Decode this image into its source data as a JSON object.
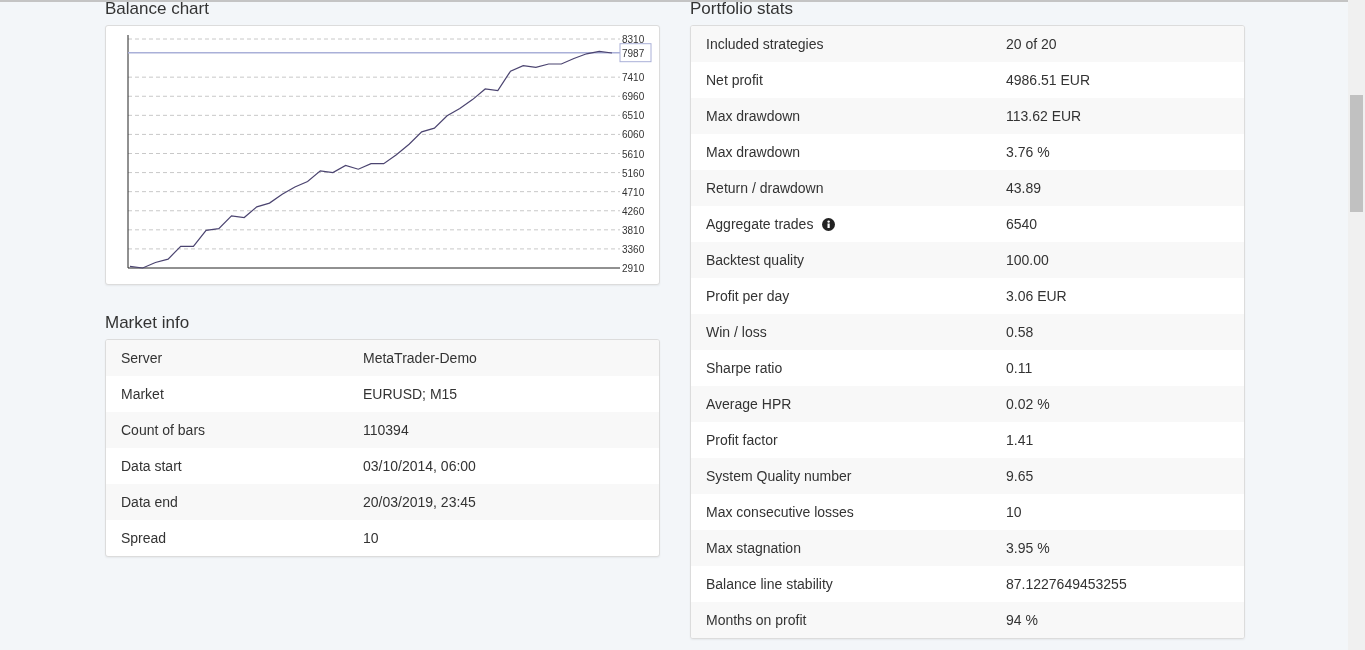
{
  "balance_chart": {
    "title": "Balance chart",
    "chart_data": {
      "type": "line",
      "grid": true,
      "ylim": [
        2910,
        8310
      ],
      "yticks": [
        2910,
        3360,
        3810,
        4260,
        4710,
        5160,
        5610,
        6060,
        6510,
        6960,
        7410,
        8310
      ],
      "series": [
        {
          "color": "#4b4470",
          "values": [
            2950,
            2910,
            3040,
            3120,
            3420,
            3420,
            3800,
            3840,
            4140,
            4100,
            4350,
            4440,
            4650,
            4820,
            4950,
            5200,
            5160,
            5330,
            5240,
            5370,
            5370,
            5580,
            5830,
            6120,
            6210,
            6500,
            6670,
            6880,
            7130,
            7090,
            7550,
            7680,
            7640,
            7720,
            7720,
            7850,
            7960,
            8020,
            7980
          ]
        }
      ],
      "ref_lines": [
        {
          "axis": "y",
          "value": 7987,
          "label": "7987",
          "color": "#aab0d8"
        }
      ]
    }
  },
  "market_info": {
    "title": "Market info",
    "rows": [
      {
        "label": "Server",
        "value": "MetaTrader-Demo"
      },
      {
        "label": "Market",
        "value": "EURUSD; M15"
      },
      {
        "label": "Count of bars",
        "value": "110394"
      },
      {
        "label": "Data start",
        "value": "03/10/2014, 06:00"
      },
      {
        "label": "Data end",
        "value": "20/03/2019, 23:45"
      },
      {
        "label": "Spread",
        "value": "10"
      }
    ]
  },
  "portfolio_stats": {
    "title": "Portfolio stats",
    "rows": [
      {
        "label": "Included strategies",
        "value": "20 of 20"
      },
      {
        "label": "Net profit",
        "value": "4986.51 EUR"
      },
      {
        "label": "Max drawdown",
        "value": "113.62 EUR"
      },
      {
        "label": "Max drawdown",
        "value": "3.76 %"
      },
      {
        "label": "Return / drawdown",
        "value": "43.89"
      },
      {
        "label": "Aggregate trades",
        "value": "6540",
        "info": true
      },
      {
        "label": "Backtest quality",
        "value": "100.00"
      },
      {
        "label": "Profit per day",
        "value": "3.06 EUR"
      },
      {
        "label": "Win / loss",
        "value": "0.58"
      },
      {
        "label": "Sharpe ratio",
        "value": "0.11"
      },
      {
        "label": "Average HPR",
        "value": "0.02 %"
      },
      {
        "label": "Profit factor",
        "value": "1.41"
      },
      {
        "label": "System Quality number",
        "value": "9.65"
      },
      {
        "label": "Max consecutive losses",
        "value": "10"
      },
      {
        "label": "Max stagnation",
        "value": "3.95 %"
      },
      {
        "label": "Balance line stability",
        "value": "87.1227649453255"
      },
      {
        "label": "Months on profit",
        "value": "94 %"
      }
    ]
  }
}
